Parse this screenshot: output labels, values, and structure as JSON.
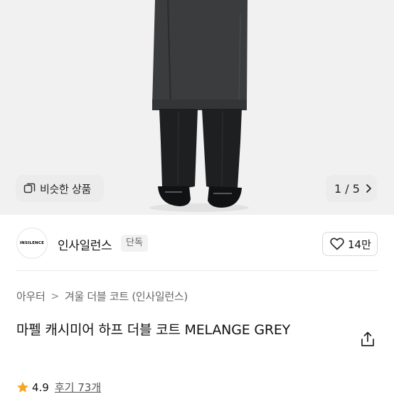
{
  "hero": {
    "similar_label": "비슷한 상품",
    "page_indicator": "1 / 5"
  },
  "brand": {
    "logo_text": "INSILENCE",
    "name": "인사일런스",
    "badge": "단독",
    "like_count": "14만"
  },
  "breadcrumb": {
    "items": [
      "아우터",
      "겨울 더블 코트 (인사일런스)"
    ],
    "separator": ">"
  },
  "product": {
    "title": "마펠 캐시미어 하프 더블 코트 MELANGE GREY"
  },
  "rating": {
    "score": "4.9",
    "reviews": "후기 73개",
    "star_color": "#f5a623"
  },
  "colors": {
    "hero_bg": "#f1f1f1",
    "coat": "#3a3b3d",
    "trousers": "#1c1d1f"
  }
}
